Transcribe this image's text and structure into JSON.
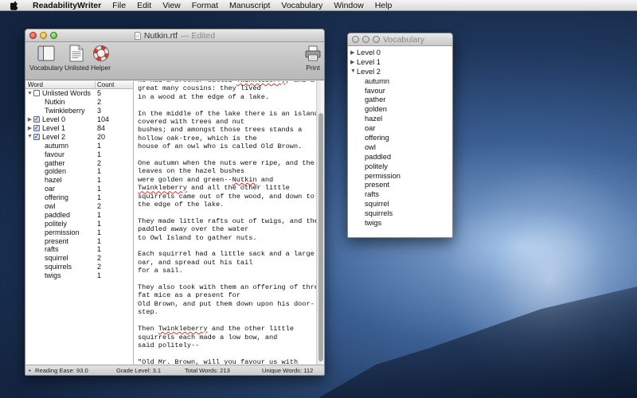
{
  "menubar": {
    "app_name": "ReadabilityWriter",
    "items": [
      "File",
      "Edit",
      "View",
      "Format",
      "Manuscript",
      "Vocabulary",
      "Window",
      "Help"
    ]
  },
  "main_window": {
    "title": "Nutkin.rtf",
    "title_suffix": "— Edited",
    "toolbar": {
      "vocabulary_label": "Vocabulary",
      "unlisted_label": "Unlisted",
      "helper_label": "Helper",
      "print_label": "Print"
    },
    "word_list": {
      "col_word": "Word",
      "col_count": "Count",
      "rows": [
        {
          "word": "Unlisted Words",
          "count": "5",
          "level": 0,
          "disclosure": "open",
          "checkbox": "unchecked"
        },
        {
          "word": "Nutkin",
          "count": "2",
          "level": 1
        },
        {
          "word": "Twinkleberry",
          "count": "3",
          "level": 1
        },
        {
          "word": "Level 0",
          "count": "104",
          "level": 0,
          "disclosure": "closed",
          "checkbox": "checked"
        },
        {
          "word": "Level 1",
          "count": "84",
          "level": 0,
          "disclosure": "closed",
          "checkbox": "checked"
        },
        {
          "word": "Level 2",
          "count": "20",
          "level": 0,
          "disclosure": "open",
          "checkbox": "checked"
        },
        {
          "word": "autumn",
          "count": "1",
          "level": 1
        },
        {
          "word": "favour",
          "count": "1",
          "level": 1
        },
        {
          "word": "gather",
          "count": "2",
          "level": 1
        },
        {
          "word": "golden",
          "count": "1",
          "level": 1
        },
        {
          "word": "hazel",
          "count": "1",
          "level": 1
        },
        {
          "word": "oar",
          "count": "1",
          "level": 1
        },
        {
          "word": "offering",
          "count": "1",
          "level": 1
        },
        {
          "word": "owl",
          "count": "2",
          "level": 1
        },
        {
          "word": "paddled",
          "count": "1",
          "level": 1
        },
        {
          "word": "politely",
          "count": "1",
          "level": 1
        },
        {
          "word": "permission",
          "count": "1",
          "level": 1
        },
        {
          "word": "present",
          "count": "1",
          "level": 1
        },
        {
          "word": "rafts",
          "count": "1",
          "level": 1
        },
        {
          "word": "squirrel",
          "count": "2",
          "level": 1
        },
        {
          "word": "squirrels",
          "count": "2",
          "level": 1
        },
        {
          "word": "twigs",
          "count": "1",
          "level": 1
        }
      ]
    },
    "text_paragraphs": [
      [
        [
          "He had a brother called ",
          ""
        ],
        [
          "Twinkleberry",
          "sp"
        ],
        [
          ", and a",
          ""
        ],
        [
          "\ngreat many cousins: they lived\nin a wood at the edge of a lake.",
          ""
        ]
      ],
      [
        [
          "In the middle of the lake there is an island\ncovered with trees and nut\nbushes; and amongst those trees stands a\nhollow oak-tree, which is the\nhouse of an owl who is called Old Brown.",
          ""
        ]
      ],
      [
        [
          "One autumn when the nuts were ripe, and the\nleaves on the hazel bushes\nwere golden and green--",
          ""
        ],
        [
          "Nutkin",
          "sp"
        ],
        [
          " and\n",
          ""
        ],
        [
          "Twinkleberry",
          "sp"
        ],
        [
          " and all the other little\nsquirrels came out of the wood, and down to\nthe edge of the lake.",
          ""
        ]
      ],
      [
        [
          "They made little rafts out of twigs, and they\npaddled away over the water\nto Owl Island to gather nuts.",
          ""
        ]
      ],
      [
        [
          "Each squirrel had a little sack and a large\noar, and spread out his tail\nfor a sail.",
          ""
        ]
      ],
      [
        [
          "They also took with them an offering of three\nfat mice as a present for\nOld Brown, and put them down upon his door-\nstep.",
          ""
        ]
      ],
      [
        [
          "Then ",
          ""
        ],
        [
          "Twinkleberry",
          "sp"
        ],
        [
          " and the other little\nsquirrels each made a low bow, and\nsaid politely--",
          ""
        ]
      ],
      [
        [
          "\"Old Mr. Brown, will you ",
          ""
        ],
        [
          "favour",
          "fav"
        ],
        [
          " us with\npermission to gather nuts upon\nyour island?\"",
          ""
        ]
      ]
    ],
    "status": {
      "reading_ease": "Reading Ease: 93.0",
      "grade_level": "Grade Level: 3.1",
      "total_words": "Total Words: 213",
      "unique_words": "Unique Words: 112"
    }
  },
  "vocab_window": {
    "title": "Vocabulary",
    "items": [
      {
        "label": "Level 0",
        "disclosure": "closed",
        "child": false
      },
      {
        "label": "Level 1",
        "disclosure": "closed",
        "child": false
      },
      {
        "label": "Level 2",
        "disclosure": "open",
        "child": false
      },
      {
        "label": "autumn",
        "child": true
      },
      {
        "label": "favour",
        "child": true
      },
      {
        "label": "gather",
        "child": true
      },
      {
        "label": "golden",
        "child": true
      },
      {
        "label": "hazel",
        "child": true
      },
      {
        "label": "oar",
        "child": true
      },
      {
        "label": "offering",
        "child": true
      },
      {
        "label": "owl",
        "child": true
      },
      {
        "label": "paddled",
        "child": true
      },
      {
        "label": "politely",
        "child": true
      },
      {
        "label": "permission",
        "child": true
      },
      {
        "label": "present",
        "child": true
      },
      {
        "label": "rafts",
        "child": true
      },
      {
        "label": "squirrel",
        "child": true
      },
      {
        "label": "squirrels",
        "child": true
      },
      {
        "label": "twigs",
        "child": true
      }
    ]
  },
  "colors": {
    "spelling_underline": "#e0342b",
    "vocab_underline": "#3a5fd4",
    "checkbox_accent": "#1c3f8f"
  }
}
